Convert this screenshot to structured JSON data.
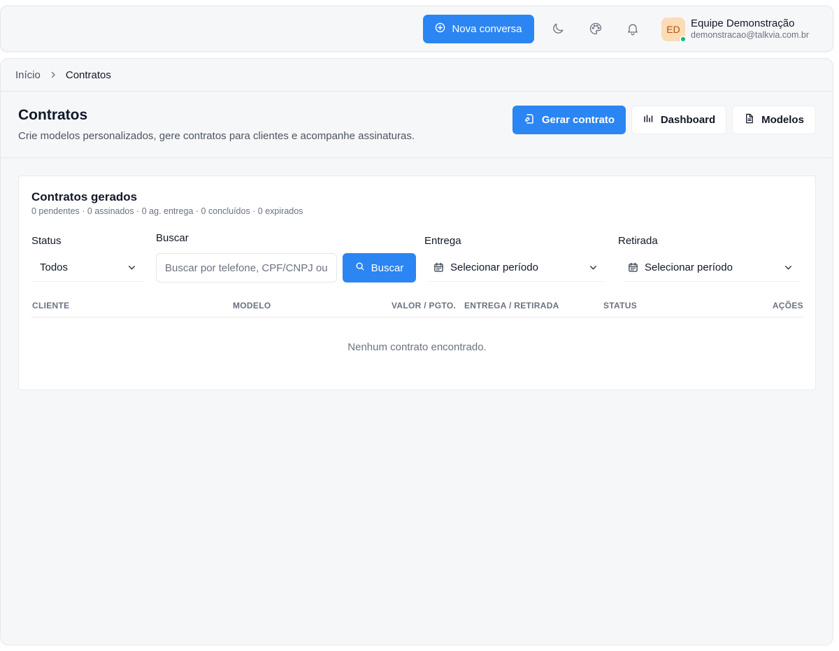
{
  "topbar": {
    "new_chat_label": "Nova conversa",
    "icons": [
      "moon-icon",
      "palette-icon",
      "bell-icon"
    ],
    "user": {
      "initials": "ED",
      "name": "Equipe Demonstração",
      "email": "demonstracao@talkvia.com.br",
      "status_color": "#10b981"
    }
  },
  "breadcrumb": {
    "home": "Início",
    "current": "Contratos"
  },
  "header": {
    "title": "Contratos",
    "subtitle": "Crie modelos personalizados, gere contratos para clientes e acompanhe assinaturas.",
    "actions": {
      "generate": "Gerar contrato",
      "dashboard": "Dashboard",
      "templates": "Modelos"
    }
  },
  "contracts": {
    "title": "Contratos gerados",
    "summary": "0 pendentes · 0 assinados · 0 ag. entrega · 0 concluídos · 0 expirados",
    "filters": {
      "status_label": "Status",
      "status_value": "Todos",
      "search_label": "Buscar",
      "search_placeholder": "Buscar por telefone, CPF/CNPJ ou",
      "search_button": "Buscar",
      "delivery_label": "Entrega",
      "delivery_value": "Selecionar período",
      "pickup_label": "Retirada",
      "pickup_value": "Selecionar período"
    },
    "columns": [
      "CLIENTE",
      "MODELO",
      "VALOR / PGTO.",
      "ENTREGA / RETIRADA",
      "STATUS",
      "AÇÕES"
    ],
    "empty_message": "Nenhum contrato encontrado."
  },
  "colors": {
    "accent": "#2b85f2",
    "background": "#f6f7f8"
  }
}
